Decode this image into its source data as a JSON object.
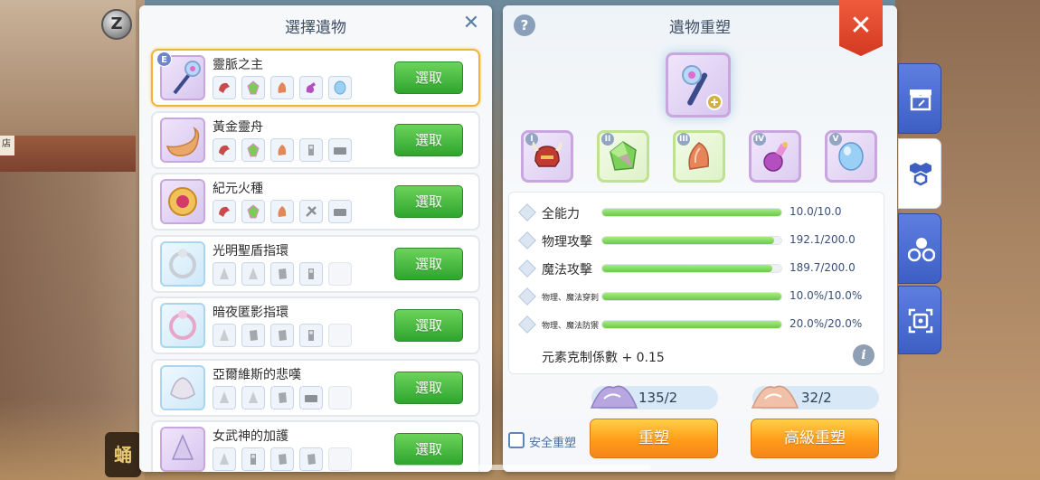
{
  "left_panel": {
    "title": "選擇遺物",
    "pick_label": "選取",
    "items": [
      {
        "name": "靈脈之主",
        "badge": "E",
        "selected": true,
        "icon": "staff-relic-icon",
        "slots": 5
      },
      {
        "name": "黃金靈舟",
        "selected": false,
        "icon": "golden-boat-icon",
        "slots": 5
      },
      {
        "name": "紀元火種",
        "selected": false,
        "icon": "epoch-flame-icon",
        "slots": 5
      },
      {
        "name": "光明聖盾指環",
        "selected": false,
        "icon": "ring-icon",
        "slots": 4
      },
      {
        "name": "暗夜匿影指環",
        "selected": false,
        "icon": "ring-icon",
        "slots": 4
      },
      {
        "name": "亞爾維斯的悲嘆",
        "selected": false,
        "icon": "ornament-icon",
        "slots": 4
      },
      {
        "name": "女武神的加護",
        "selected": false,
        "icon": "valkyrie-icon",
        "slots": 4
      }
    ]
  },
  "right_panel": {
    "title": "遺物重塑",
    "slots": [
      {
        "roman": "I",
        "icon": "helmet-icon",
        "frame": "purple"
      },
      {
        "roman": "II",
        "icon": "green-gem-icon",
        "frame": "green"
      },
      {
        "roman": "III",
        "icon": "orange-crystal-icon",
        "frame": "green"
      },
      {
        "roman": "IV",
        "icon": "potion-icon",
        "frame": "purple"
      },
      {
        "roman": "V",
        "icon": "blue-gem-icon",
        "frame": "purple"
      }
    ],
    "stats": [
      {
        "label": "全能力",
        "value": "10.0/10.0",
        "fill": 1.0,
        "size": "big"
      },
      {
        "label": "物理攻擊",
        "value": "192.1/200.0",
        "fill": 0.96,
        "size": "big"
      },
      {
        "label": "魔法攻擊",
        "value": "189.7/200.0",
        "fill": 0.95,
        "size": "big"
      },
      {
        "label": "物理、魔法穿刺",
        "value": "10.0%/10.0%",
        "fill": 1.0,
        "size": "small"
      },
      {
        "label": "物理、魔法防禦",
        "value": "20.0%/20.0%",
        "fill": 1.0,
        "size": "small"
      }
    ],
    "element_coef": "元素克制係數 + 0.15",
    "materials": [
      {
        "count": "135/2",
        "color": "#b8a6e0"
      },
      {
        "count": "32/2",
        "color": "#f0b8a0"
      }
    ],
    "safe_label": "安全重塑",
    "reshape_label": "重塑",
    "advanced_reshape_label": "高級重塑"
  },
  "side_tabs": [
    {
      "icon": "shop-icon",
      "active": false
    },
    {
      "icon": "hex-cluster-icon",
      "active": true
    },
    {
      "icon": "circles-icon",
      "active": false
    },
    {
      "icon": "scan-icon",
      "active": false
    }
  ],
  "overlay": {
    "z_badge": "Z",
    "game_logo": "蛹",
    "shop_sign": "店"
  },
  "colors": {
    "accent_green": "#2ea52e",
    "accent_orange": "#ff9c1a",
    "close_red": "#d33a21",
    "tab_blue": "#3d5fc4"
  }
}
